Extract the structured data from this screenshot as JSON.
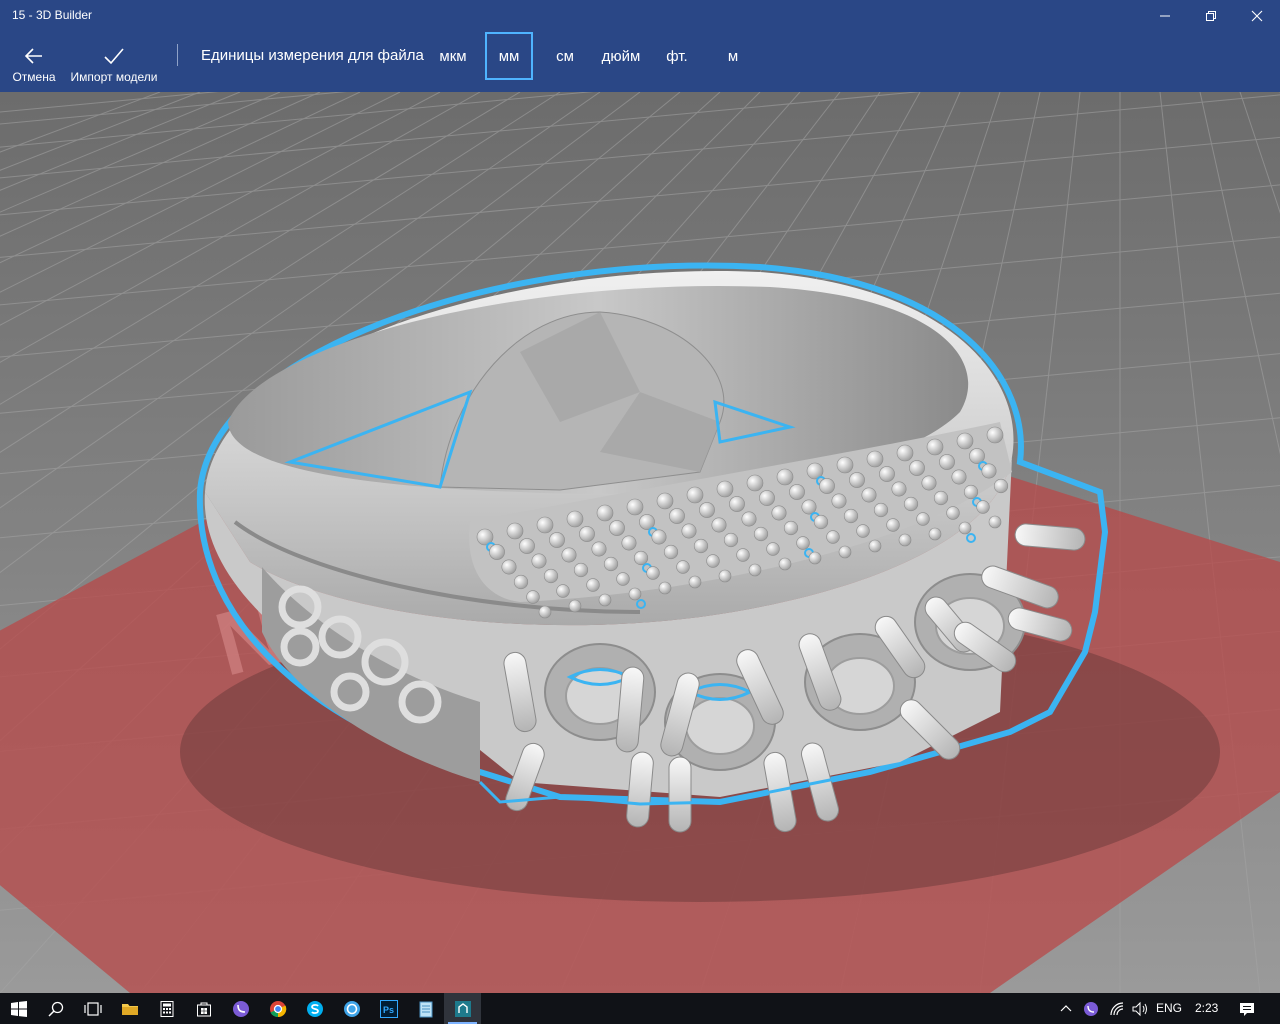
{
  "window": {
    "title": "15 - 3D Builder"
  },
  "toolbar": {
    "cancel_label": "Отмена",
    "import_label": "Импорт модели",
    "units_label": "Единицы измерения для файла",
    "units": [
      "мкм",
      "мм",
      "см",
      "дюйм",
      "фт.",
      "м"
    ],
    "selected_unit": "мм"
  },
  "viewport": {
    "plate_watermark": "WIN",
    "selection_color": "#3bb4f2",
    "plate_color": "#c44a4a",
    "grid_color": "#9a9a9a"
  },
  "taskbar": {
    "apps": [
      "windows-start-icon",
      "search-icon",
      "task-view-icon",
      "file-explorer-icon",
      "calculator-icon",
      "store-icon",
      "viber-icon",
      "chrome-icon",
      "skype-icon",
      "camera-app-icon",
      "photoshop-icon",
      "notepad-icon",
      "3d-builder-icon"
    ],
    "photoshop_text": "Ps",
    "language": "ENG",
    "time": "2:23"
  }
}
